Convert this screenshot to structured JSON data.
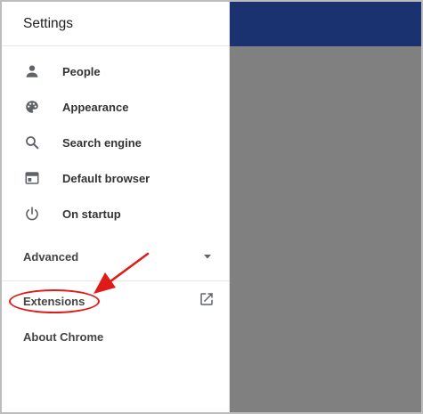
{
  "drawer": {
    "title": "Settings",
    "items": [
      {
        "label": "People",
        "icon": "person-icon"
      },
      {
        "label": "Appearance",
        "icon": "palette-icon"
      },
      {
        "label": "Search engine",
        "icon": "search-icon"
      },
      {
        "label": "Default browser",
        "icon": "browser-window-icon"
      },
      {
        "label": "On startup",
        "icon": "power-icon"
      }
    ],
    "advanced_label": "Advanced",
    "extensions_label": "Extensions",
    "about_label": "About Chrome"
  },
  "colors": {
    "header_bar": "#1a3370",
    "scrim": "#808080",
    "annotation": "#e01919",
    "icon": "#5f6368"
  }
}
